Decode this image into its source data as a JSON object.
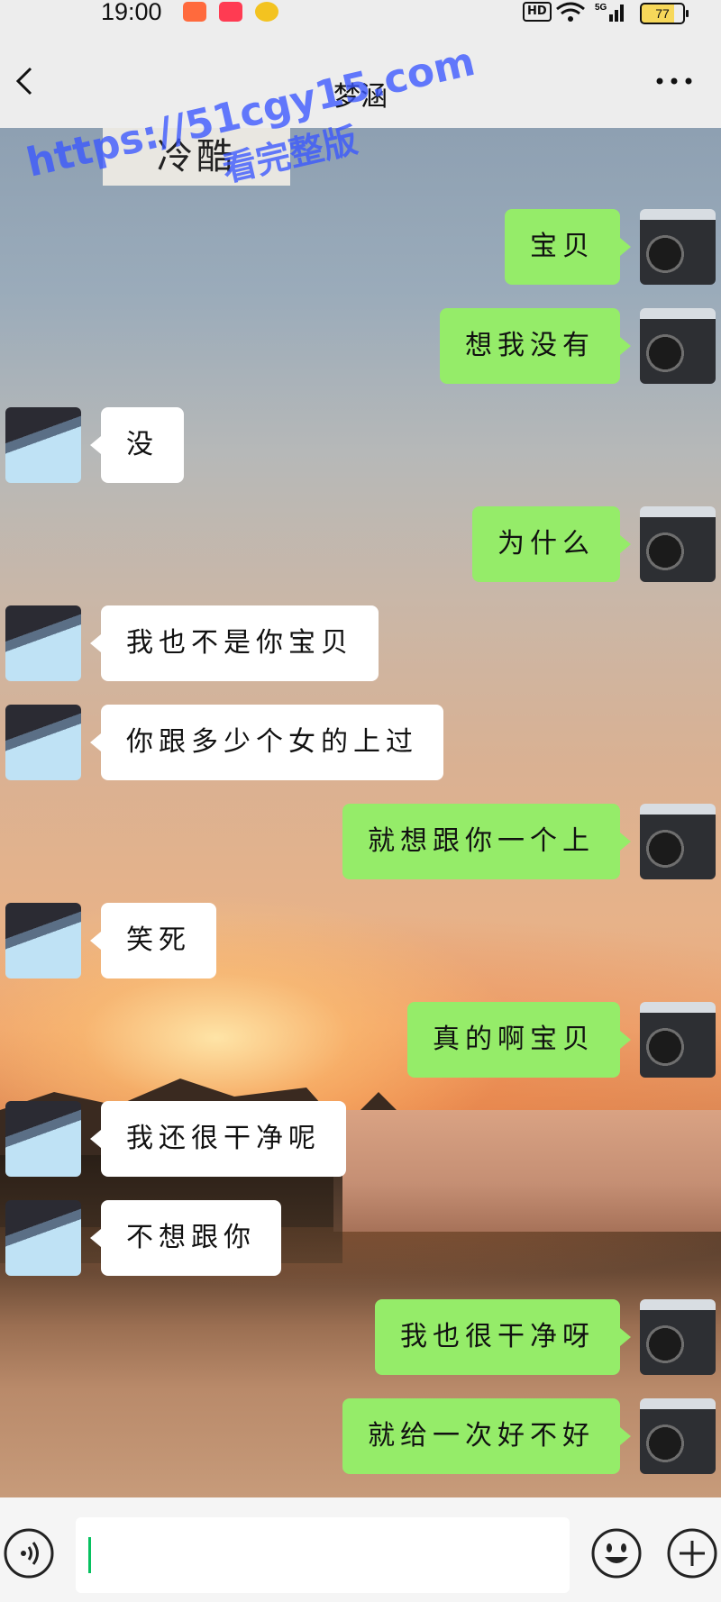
{
  "status_bar": {
    "time": "19:00",
    "hd": "HD",
    "network": "5G",
    "battery": "77"
  },
  "nav": {
    "title": "梦涵"
  },
  "chat": {
    "top_image_text": "冷酷",
    "messages": [
      {
        "side": "out",
        "text": "宝贝"
      },
      {
        "side": "out",
        "text": "想我没有"
      },
      {
        "side": "in",
        "text": "没"
      },
      {
        "side": "out",
        "text": "为什么"
      },
      {
        "side": "in",
        "text": "我也不是你宝贝"
      },
      {
        "side": "in",
        "text": "你跟多少个女的上过"
      },
      {
        "side": "out",
        "text": "就想跟你一个上"
      },
      {
        "side": "in",
        "text": "笑死"
      },
      {
        "side": "out",
        "text": "真的啊宝贝"
      },
      {
        "side": "in",
        "text": "我还很干净呢"
      },
      {
        "side": "in",
        "text": "不想跟你"
      },
      {
        "side": "out",
        "text": "我也很干净呀"
      },
      {
        "side": "out",
        "text": "就给一次好不好"
      }
    ]
  },
  "input": {
    "value": ""
  },
  "watermark": {
    "url": "https://51cgy15.com",
    "text": "看完整版"
  },
  "colors": {
    "out_bubble": "#95ec69",
    "in_bubble": "#ffffff",
    "background": "#ededed"
  },
  "icons": {
    "back": "chevron-left-icon",
    "more": "ellipsis-icon",
    "voice": "voice-icon",
    "emoji": "smiley-icon",
    "plus": "plus-icon"
  }
}
